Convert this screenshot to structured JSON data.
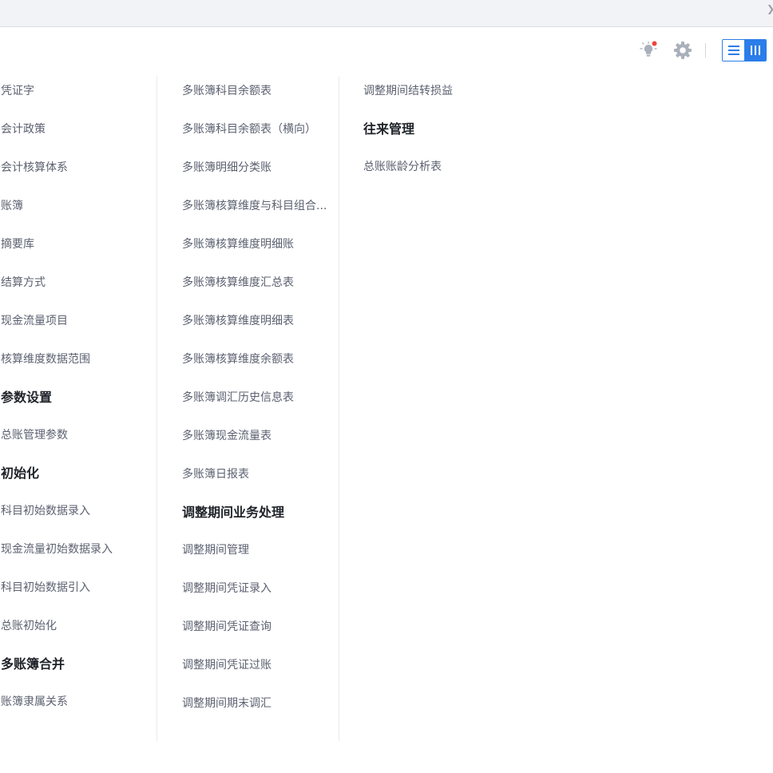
{
  "colors": {
    "accent": "#2b7de9",
    "notification_dot": "#f0443a",
    "item_text": "#5b6170",
    "heading_text": "#1f2329",
    "topbar_bg": "#f2f3f6"
  },
  "toolbar": {
    "icons": [
      "lightbulb-icon",
      "gear-icon"
    ],
    "view_toggle": [
      "list-view-icon",
      "column-view-icon"
    ],
    "active_view": "column-view"
  },
  "columns": [
    {
      "entries": [
        {
          "type": "item",
          "text": "凭证字"
        },
        {
          "type": "item",
          "text": "会计政策"
        },
        {
          "type": "item",
          "text": "会计核算体系"
        },
        {
          "type": "item",
          "text": "账簿"
        },
        {
          "type": "item",
          "text": "摘要库"
        },
        {
          "type": "item",
          "text": "结算方式"
        },
        {
          "type": "item",
          "text": "现金流量项目"
        },
        {
          "type": "item",
          "text": "核算维度数据范围"
        },
        {
          "type": "heading",
          "text": "参数设置"
        },
        {
          "type": "item",
          "text": "总账管理参数"
        },
        {
          "type": "heading",
          "text": "初始化"
        },
        {
          "type": "item",
          "text": "科目初始数据录入"
        },
        {
          "type": "item",
          "text": "现金流量初始数据录入"
        },
        {
          "type": "item",
          "text": "科目初始数据引入"
        },
        {
          "type": "item",
          "text": "总账初始化"
        },
        {
          "type": "heading",
          "text": "多账簿合并"
        },
        {
          "type": "item",
          "text": "账簿隶属关系"
        }
      ]
    },
    {
      "entries": [
        {
          "type": "item",
          "text": "多账簿科目余额表"
        },
        {
          "type": "item",
          "text": "多账簿科目余额表（横向）"
        },
        {
          "type": "item",
          "text": "多账簿明细分类账"
        },
        {
          "type": "item",
          "text": "多账簿核算维度与科目组合..."
        },
        {
          "type": "item",
          "text": "多账簿核算维度明细账"
        },
        {
          "type": "item",
          "text": "多账簿核算维度汇总表"
        },
        {
          "type": "item",
          "text": "多账簿核算维度明细表"
        },
        {
          "type": "item",
          "text": "多账簿核算维度余额表"
        },
        {
          "type": "item",
          "text": "多账簿调汇历史信息表"
        },
        {
          "type": "item",
          "text": "多账簿现金流量表"
        },
        {
          "type": "item",
          "text": "多账簿日报表"
        },
        {
          "type": "heading",
          "text": "调整期间业务处理"
        },
        {
          "type": "item",
          "text": "调整期间管理"
        },
        {
          "type": "item",
          "text": "调整期间凭证录入"
        },
        {
          "type": "item",
          "text": "调整期间凭证查询"
        },
        {
          "type": "item",
          "text": "调整期间凭证过账"
        },
        {
          "type": "item",
          "text": "调整期间期末调汇"
        }
      ]
    },
    {
      "entries": [
        {
          "type": "item",
          "text": "调整期间结转损益"
        },
        {
          "type": "heading",
          "text": "往来管理"
        },
        {
          "type": "item",
          "text": "总账账龄分析表"
        }
      ]
    }
  ]
}
